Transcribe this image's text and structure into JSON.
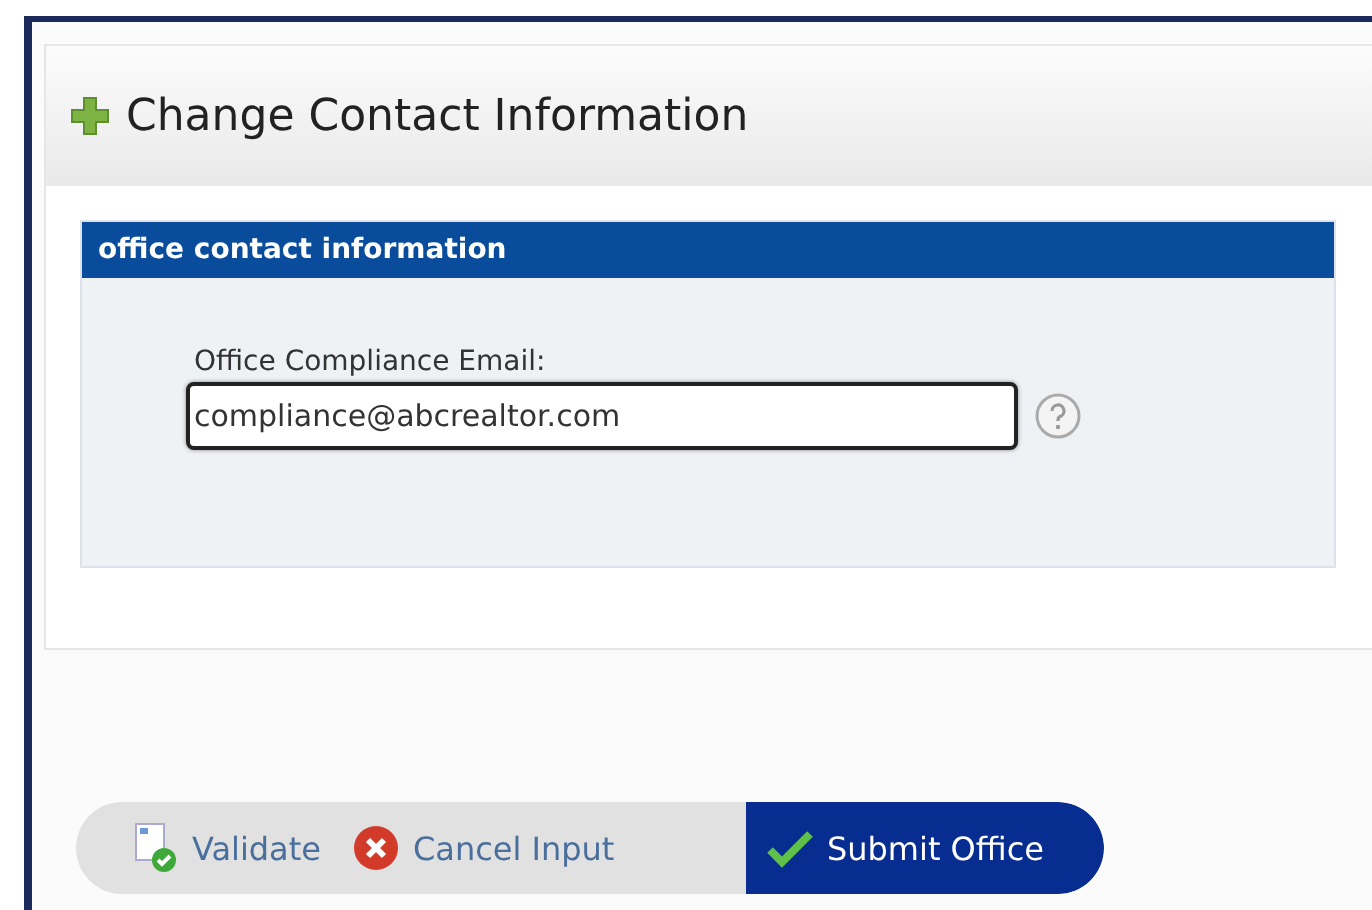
{
  "panel": {
    "title": "Change Contact Information"
  },
  "section": {
    "title": "office contact information",
    "field": {
      "label": "Office Compliance Email:",
      "value": "compliance@abcrealtor.com",
      "focused": true
    }
  },
  "buttons": [
    {
      "label": "Validate",
      "kind": "validate",
      "primary": false
    },
    {
      "label": "Cancel Input",
      "kind": "cancel",
      "primary": false
    },
    {
      "label": "Submit Office",
      "kind": "submit",
      "primary": true
    }
  ]
}
